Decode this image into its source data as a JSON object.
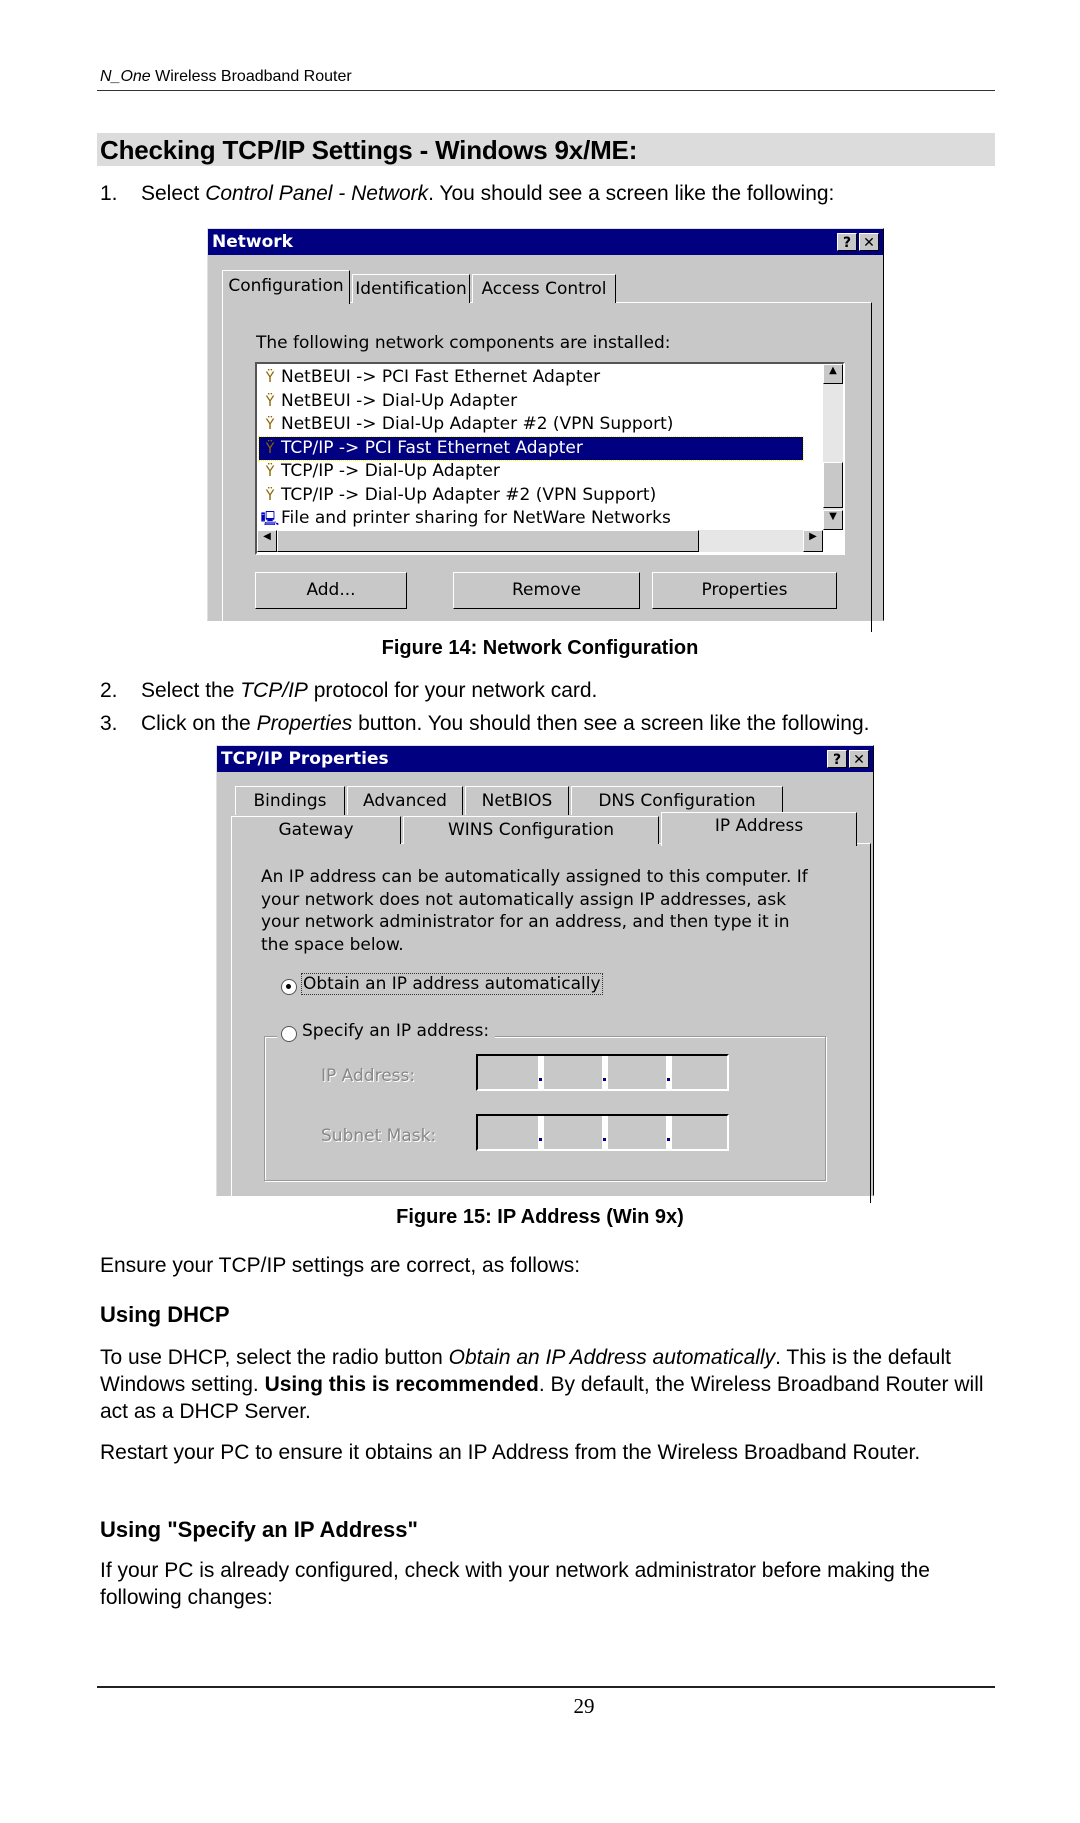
{
  "header": {
    "product_italic": "N_One",
    "product_rest": " Wireless Broadband Router"
  },
  "section_title": "Checking TCP/IP Settings - Windows 9x/ME:",
  "steps": [
    {
      "num": "1.",
      "pre": "Select ",
      "em": "Control Panel - Network",
      "post": ". You should see a screen like the following:"
    },
    {
      "num": "2.",
      "pre": "Select the ",
      "em": "TCP/IP",
      "post": " protocol for your network card."
    },
    {
      "num": "3.",
      "pre": "Click on the ",
      "em": "Properties",
      "post": " button. You should then see a screen like the following."
    }
  ],
  "network_dialog": {
    "title": "Network",
    "help_btn": "?",
    "close_btn": "✕",
    "tabs": [
      "Configuration",
      "Identification",
      "Access Control"
    ],
    "active_tab": "Configuration",
    "list_label": "The following network components are installed:",
    "list_items": [
      {
        "icon": "network-protocol-icon",
        "label": "NetBEUI -> PCI Fast Ethernet Adapter",
        "selected": false
      },
      {
        "icon": "network-protocol-icon",
        "label": "NetBEUI -> Dial-Up Adapter",
        "selected": false
      },
      {
        "icon": "network-protocol-icon",
        "label": "NetBEUI -> Dial-Up Adapter #2 (VPN Support)",
        "selected": false
      },
      {
        "icon": "network-protocol-icon",
        "label": "TCP/IP -> PCI Fast Ethernet Adapter",
        "selected": true
      },
      {
        "icon": "network-protocol-icon",
        "label": "TCP/IP -> Dial-Up Adapter",
        "selected": false
      },
      {
        "icon": "network-protocol-icon",
        "label": "TCP/IP -> Dial-Up Adapter #2 (VPN Support)",
        "selected": false
      },
      {
        "icon": "computer-share-icon",
        "label": "File and printer sharing for NetWare Networks",
        "selected": false
      }
    ],
    "buttons": {
      "add": "Add...",
      "remove": "Remove",
      "properties": "Properties"
    }
  },
  "figure14_caption": "Figure 14: Network Configuration",
  "tcpip_dialog": {
    "title": "TCP/IP Properties",
    "help_btn": "?",
    "close_btn": "✕",
    "tabs_row1": [
      "Bindings",
      "Advanced",
      "NetBIOS",
      "DNS Configuration"
    ],
    "tabs_row2": [
      "Gateway",
      "WINS Configuration",
      "IP Address"
    ],
    "active_tab": "IP Address",
    "description": "An IP address can be automatically assigned to this computer.  If your network does not automatically assign IP addresses, ask your network administrator for an address, and then type it in the space below.",
    "radio_obtain": "Obtain an IP address automatically",
    "radio_obtain_selected": true,
    "radio_specify": "Specify an IP address:",
    "radio_specify_selected": false,
    "ip_address_label": "IP Address:",
    "subnet_mask_label": "Subnet Mask:",
    "ip_address_value": [
      "",
      "",
      "",
      ""
    ],
    "subnet_mask_value": [
      "",
      "",
      "",
      ""
    ]
  },
  "figure15_caption": "Figure 15: IP Address (Win 9x)",
  "ensure_text": "Ensure your TCP/IP settings are correct, as follows:",
  "dhcp": {
    "heading": "Using DHCP",
    "p1_a": "To use DHCP, select the radio button ",
    "p1_em": "Obtain an IP Address automatically",
    "p1_b": ". This is the default Windows setting. ",
    "p1_strong": "Using this is recommended",
    "p1_c": ". By default, the Wireless Broadband Router will act as a DHCP Server.",
    "p2": "Restart your PC to ensure it obtains an IP Address from the Wireless Broadband Router."
  },
  "specify": {
    "heading": "Using \"Specify an IP Address\"",
    "p1": "If your PC is already configured, check with your network administrator before making the following changes:"
  },
  "page_number": "29"
}
